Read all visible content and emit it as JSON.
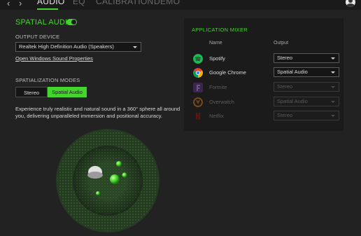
{
  "nav": {
    "back_glyph": "‹",
    "forward_glyph": "›",
    "tabs": [
      {
        "label": "AUDIO",
        "active": true
      },
      {
        "label": "EQ",
        "active": false
      },
      {
        "label": "CALIBRATION",
        "active": false
      },
      {
        "label": "DEMO",
        "active": false
      }
    ]
  },
  "spatial_audio": {
    "title": "SPATIAL AUDIO",
    "enabled": true
  },
  "output_device": {
    "label": "OUTPUT DEVICE",
    "selected": "Realtek High Definition Audio (Speakers)",
    "link": "Open Windows Sound Properties"
  },
  "spatialization": {
    "label": "SPATIALIZATION MODES",
    "options": [
      "Stereo",
      "Spatial Audio"
    ],
    "selected": "Spatial Audio",
    "description": "Experience truly realistic and natural sound in a 360° sphere all around you, delivering unparalleled immersion and positional accuracy."
  },
  "mixer": {
    "title": "APPLICATION MIXER",
    "col_name": "Name",
    "col_output": "Output",
    "rows": [
      {
        "name": "Spotify",
        "output": "Stereo",
        "icon": "spotify-icon",
        "enabled": true,
        "color": "#1db954"
      },
      {
        "name": "Google Chrome",
        "output": "Spatial Audio",
        "icon": "chrome-icon",
        "enabled": true,
        "color": "#4285f4"
      },
      {
        "name": "Fortnite",
        "output": "Stereo",
        "icon": "fortnite-icon",
        "enabled": false,
        "color": "#6a3d8a"
      },
      {
        "name": "Overwatch",
        "output": "Spatial Audio",
        "icon": "overwatch-icon",
        "enabled": false,
        "color": "#b56a1c"
      },
      {
        "name": "Netflix",
        "output": "Stereo",
        "icon": "netflix-icon",
        "enabled": false,
        "color": "#7a1a1a"
      }
    ]
  },
  "colors": {
    "accent": "#44d62c",
    "background": "#222222",
    "panel": "#1b1b1b"
  }
}
